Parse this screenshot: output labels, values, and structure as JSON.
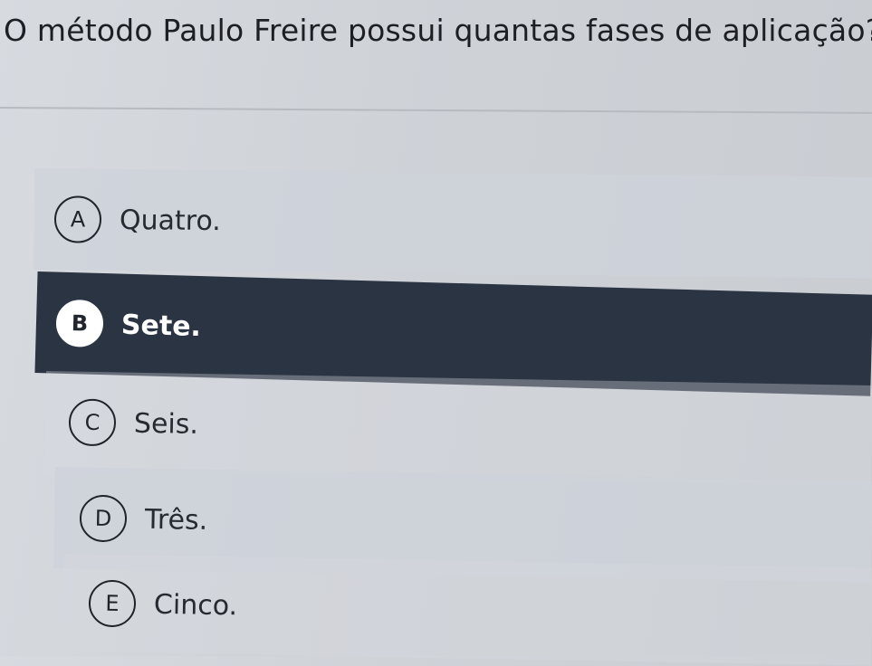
{
  "question": {
    "text": "O método Paulo Freire possui quantas fases de aplicação?"
  },
  "options": [
    {
      "letter": "A",
      "text": "Quatro.",
      "selected": false
    },
    {
      "letter": "B",
      "text": "Sete.",
      "selected": true
    },
    {
      "letter": "C",
      "text": "Seis.",
      "selected": false
    },
    {
      "letter": "D",
      "text": "Três.",
      "selected": false
    },
    {
      "letter": "E",
      "text": "Cinco.",
      "selected": false
    }
  ],
  "colors": {
    "selected_background": "#2b3443",
    "text": "#1d1f24",
    "selected_text": "#ffffff"
  }
}
